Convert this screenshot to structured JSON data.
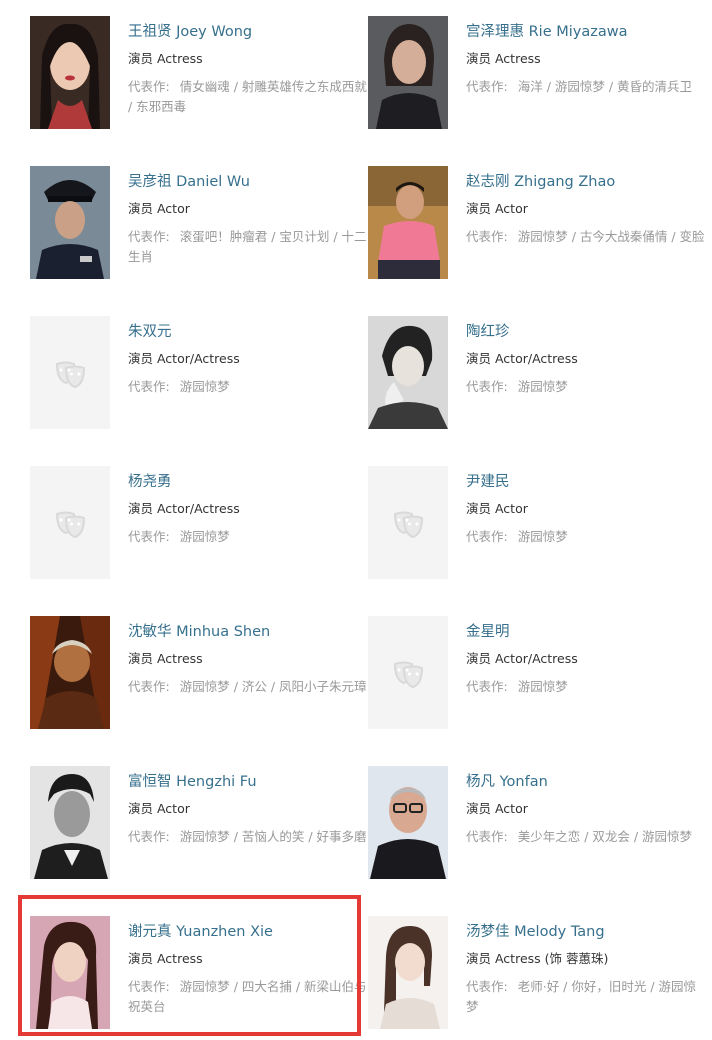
{
  "works_label": "代表作:",
  "placeholder_icon": "drama-mask-icon",
  "highlight_color": "#e53935",
  "name_color": "#37708d",
  "celebrities": [
    {
      "name": "王祖贤 Joey Wong",
      "role": "演员 Actress",
      "works": "倩女幽魂 / 射雕英雄传之东成西就 / 东邪西毒",
      "photo": "photo"
    },
    {
      "name": "宫泽理惠 Rie Miyazawa",
      "role": "演员 Actress",
      "works": "海洋 / 游园惊梦 / 黄昏的清兵卫",
      "photo": "photo"
    },
    {
      "name": "吴彦祖 Daniel Wu",
      "role": "演员 Actor",
      "works": "滚蛋吧！肿瘤君 / 宝贝计划 / 十二生肖",
      "photo": "photo"
    },
    {
      "name": "赵志刚 Zhigang Zhao",
      "role": "演员 Actor",
      "works": "游园惊梦 / 古今大战秦俑情 / 变脸",
      "photo": "photo"
    },
    {
      "name": "朱双元",
      "role": "演员 Actor/Actress",
      "works": "游园惊梦",
      "photo": "placeholder"
    },
    {
      "name": "陶红珍",
      "role": "演员 Actor/Actress",
      "works": "游园惊梦",
      "photo": "photo"
    },
    {
      "name": "杨尧勇",
      "role": "演员 Actor/Actress",
      "works": "游园惊梦",
      "photo": "placeholder"
    },
    {
      "name": "尹建民",
      "role": "演员 Actor",
      "works": "游园惊梦",
      "photo": "placeholder"
    },
    {
      "name": "沈敏华 Minhua Shen",
      "role": "演员 Actress",
      "works": "游园惊梦 / 济公 / 凤阳小子朱元璋",
      "photo": "photo"
    },
    {
      "name": "金星明",
      "role": "演员 Actor/Actress",
      "works": "游园惊梦",
      "photo": "placeholder"
    },
    {
      "name": "富恒智 Hengzhi Fu",
      "role": "演员 Actor",
      "works": "游园惊梦 / 苦恼人的笑 / 好事多磨",
      "photo": "photo"
    },
    {
      "name": "杨凡 Yonfan",
      "role": "演员 Actor",
      "works": "美少年之恋 / 双龙会 / 游园惊梦",
      "photo": "photo"
    },
    {
      "name": "谢元真 Yuanzhen Xie",
      "role": "演员 Actress",
      "works": "游园惊梦 / 四大名捕 / 新梁山伯与祝英台",
      "photo": "photo",
      "highlighted": true
    },
    {
      "name": "汤梦佳 Melody Tang",
      "role": "演员 Actress (饰 蓉蕙珠)",
      "works": "老师·好 / 你好，旧时光 / 游园惊梦",
      "photo": "photo"
    }
  ]
}
